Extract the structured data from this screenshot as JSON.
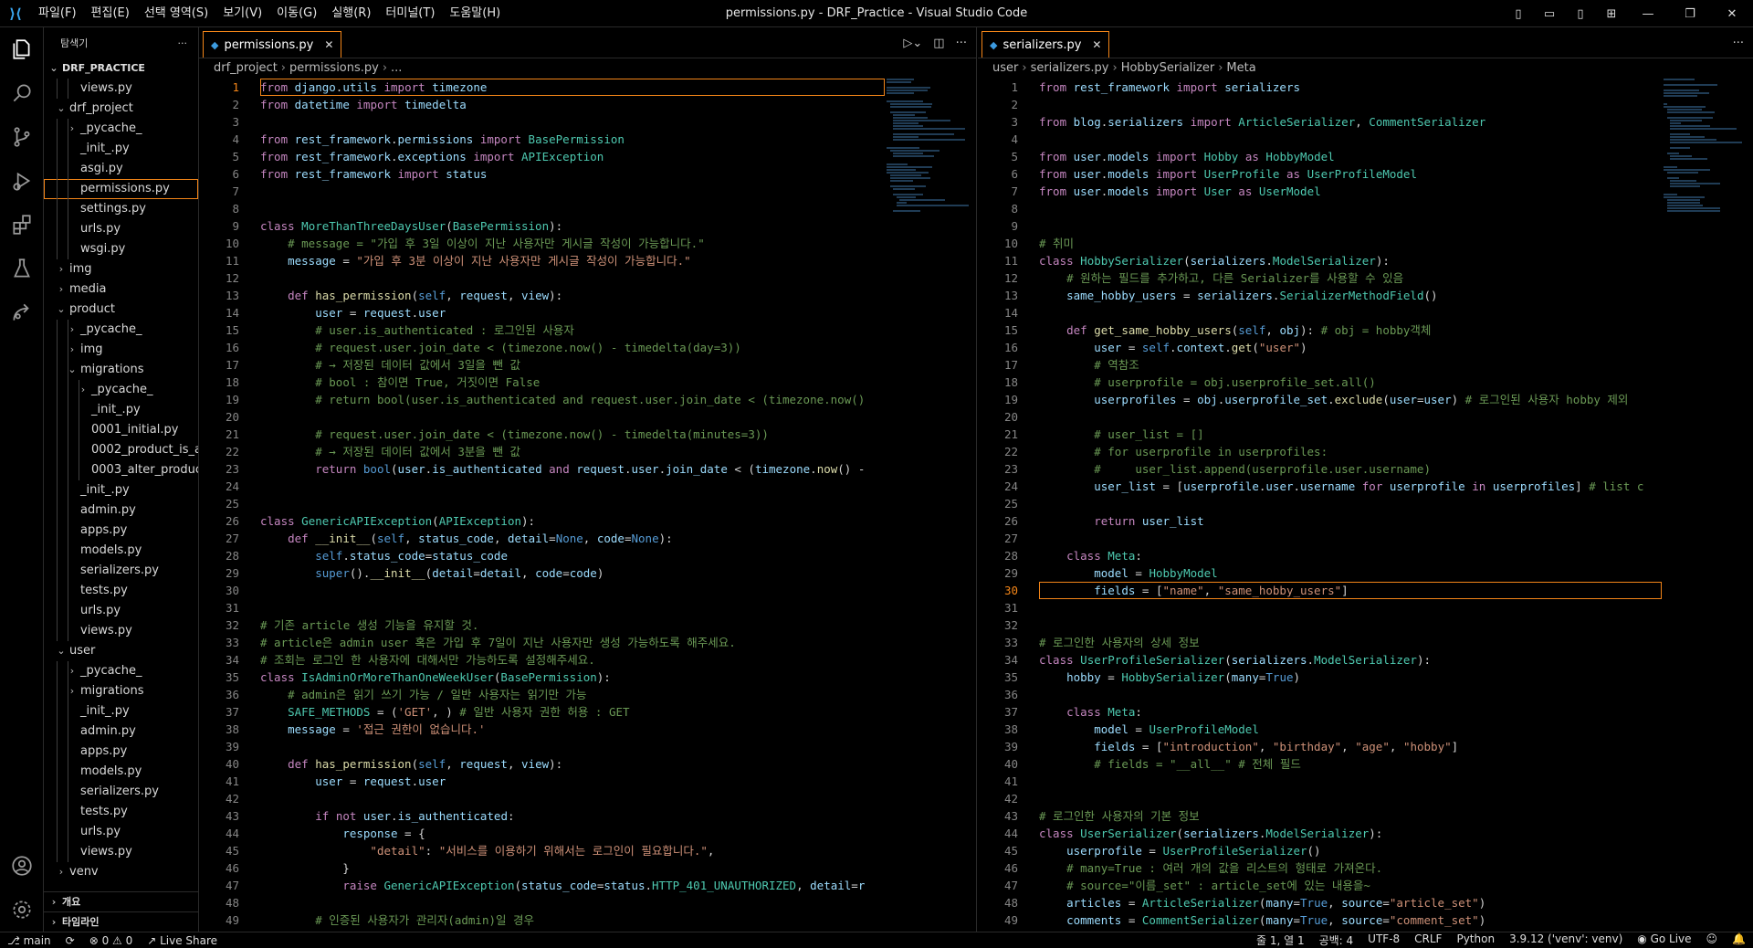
{
  "titlebar": {
    "menus": [
      "파일(F)",
      "편집(E)",
      "선택 영역(S)",
      "보기(V)",
      "이동(G)",
      "실행(R)",
      "터미널(T)",
      "도움말(H)"
    ],
    "title": "permissions.py - DRF_Practice - Visual Studio Code"
  },
  "sidebar": {
    "header": "탐색기",
    "more": "···",
    "root": "DRF_PRACTICE",
    "items": [
      {
        "label": "views.py",
        "depth": 1,
        "kind": "py"
      },
      {
        "label": "drf_project",
        "depth": 0,
        "kind": "open"
      },
      {
        "label": "_pycache_",
        "depth": 1,
        "kind": "closed"
      },
      {
        "label": "_init_.py",
        "depth": 1,
        "kind": "py"
      },
      {
        "label": "asgi.py",
        "depth": 1,
        "kind": "py"
      },
      {
        "label": "permissions.py",
        "depth": 1,
        "kind": "py",
        "selected": true
      },
      {
        "label": "settings.py",
        "depth": 1,
        "kind": "py"
      },
      {
        "label": "urls.py",
        "depth": 1,
        "kind": "py"
      },
      {
        "label": "wsgi.py",
        "depth": 1,
        "kind": "py"
      },
      {
        "label": "img",
        "depth": 0,
        "kind": "closed"
      },
      {
        "label": "media",
        "depth": 0,
        "kind": "closed"
      },
      {
        "label": "product",
        "depth": 0,
        "kind": "open"
      },
      {
        "label": "_pycache_",
        "depth": 1,
        "kind": "closed"
      },
      {
        "label": "img",
        "depth": 1,
        "kind": "closed"
      },
      {
        "label": "migrations",
        "depth": 1,
        "kind": "open"
      },
      {
        "label": "_pycache_",
        "depth": 2,
        "kind": "closed"
      },
      {
        "label": "_init_.py",
        "depth": 2,
        "kind": "py"
      },
      {
        "label": "0001_initial.py",
        "depth": 2,
        "kind": "py"
      },
      {
        "label": "0002_product_is_a...",
        "depth": 2,
        "kind": "py"
      },
      {
        "label": "0003_alter_produc...",
        "depth": 2,
        "kind": "py"
      },
      {
        "label": "_init_.py",
        "depth": 1,
        "kind": "py"
      },
      {
        "label": "admin.py",
        "depth": 1,
        "kind": "py"
      },
      {
        "label": "apps.py",
        "depth": 1,
        "kind": "py"
      },
      {
        "label": "models.py",
        "depth": 1,
        "kind": "py"
      },
      {
        "label": "serializers.py",
        "depth": 1,
        "kind": "py"
      },
      {
        "label": "tests.py",
        "depth": 1,
        "kind": "py"
      },
      {
        "label": "urls.py",
        "depth": 1,
        "kind": "py"
      },
      {
        "label": "views.py",
        "depth": 1,
        "kind": "py"
      },
      {
        "label": "user",
        "depth": 0,
        "kind": "open"
      },
      {
        "label": "_pycache_",
        "depth": 1,
        "kind": "closed"
      },
      {
        "label": "migrations",
        "depth": 1,
        "kind": "closed"
      },
      {
        "label": "_init_.py",
        "depth": 1,
        "kind": "py"
      },
      {
        "label": "admin.py",
        "depth": 1,
        "kind": "py"
      },
      {
        "label": "apps.py",
        "depth": 1,
        "kind": "py"
      },
      {
        "label": "models.py",
        "depth": 1,
        "kind": "py"
      },
      {
        "label": "serializers.py",
        "depth": 1,
        "kind": "py"
      },
      {
        "label": "tests.py",
        "depth": 1,
        "kind": "py"
      },
      {
        "label": "urls.py",
        "depth": 1,
        "kind": "py"
      },
      {
        "label": "views.py",
        "depth": 1,
        "kind": "py"
      },
      {
        "label": "venv",
        "depth": 0,
        "kind": "closed"
      }
    ],
    "outline": "개요",
    "timeline": "타임라인"
  },
  "editor1": {
    "tab": "permissions.py",
    "breadcrumb": [
      "drf_project",
      "permissions.py",
      "..."
    ],
    "current_line": 1,
    "lines": [
      "from django.utils import timezone",
      "from datetime import timedelta",
      "",
      "from rest_framework.permissions import BasePermission",
      "from rest_framework.exceptions import APIException",
      "from rest_framework import status",
      "",
      "",
      "class MoreThanThreeDaysUser(BasePermission):",
      "    # message = \"가입 후 3일 이상이 지난 사용자만 게시글 작성이 가능합니다.\"",
      "    message = \"가입 후 3분 이상이 지난 사용자만 게시글 작성이 가능합니다.\"",
      "",
      "    def has_permission(self, request, view):",
      "        user = request.user",
      "        # user.is_authenticated : 로그인된 사용자",
      "        # request.user.join_date < (timezone.now() - timedelta(day=3))",
      "        # → 저장된 데이터 값에서 3일을 뺀 값",
      "        # bool : 참이면 True, 거짓이면 False",
      "        # return bool(user.is_authenticated and request.user.join_date < (timezone.now()",
      "",
      "        # request.user.join_date < (timezone.now() - timedelta(minutes=3))",
      "        # → 저장된 데이터 값에서 3분을 뺀 값",
      "        return bool(user.is_authenticated and request.user.join_date < (timezone.now() -",
      "",
      "",
      "class GenericAPIException(APIException):",
      "    def __init__(self, status_code, detail=None, code=None):",
      "        self.status_code=status_code",
      "        super().__init__(detail=detail, code=code)",
      "",
      "",
      "# 기존 article 생성 기능을 유지할 것.",
      "# article은 admin user 혹은 가입 후 7일이 지난 사용자만 생성 가능하도록 해주세요.",
      "# 조회는 로그인 한 사용자에 대해서만 가능하도록 설정해주세요.",
      "class IsAdminOrMoreThanOneWeekUser(BasePermission):",
      "    # admin은 읽기 쓰기 가능 / 일반 사용자는 읽기만 가능",
      "    SAFE_METHODS = ('GET', ) # 일반 사용자 권한 허용 : GET",
      "    message = '접근 권한이 없습니다.'",
      "",
      "    def has_permission(self, request, view):",
      "        user = request.user",
      "",
      "        if not user.is_authenticated:",
      "            response = {",
      "                \"detail\": \"서비스를 이용하기 위해서는 로그인이 필요합니다.\",",
      "            }",
      "            raise GenericAPIException(status_code=status.HTTP_401_UNAUTHORIZED, detail=r",
      "",
      "        # 인증된 사용자가 관리자(admin)일 경우"
    ]
  },
  "editor2": {
    "tab": "serializers.py",
    "breadcrumb": [
      "user",
      "serializers.py",
      "HobbySerializer",
      "Meta"
    ],
    "current_line": 30,
    "lines": [
      "from rest_framework import serializers",
      "",
      "from blog.serializers import ArticleSerializer, CommentSerializer",
      "",
      "from user.models import Hobby as HobbyModel",
      "from user.models import UserProfile as UserProfileModel",
      "from user.models import User as UserModel",
      "",
      "",
      "# 취미",
      "class HobbySerializer(serializers.ModelSerializer):",
      "    # 원하는 필드를 추가하고, 다른 Serializer를 사용할 수 있음",
      "    same_hobby_users = serializers.SerializerMethodField()",
      "",
      "    def get_same_hobby_users(self, obj): # obj = hobby객체",
      "        user = self.context.get(\"user\")",
      "        # 역참조",
      "        # userprofile = obj.userprofile_set.all()",
      "        userprofiles = obj.userprofile_set.exclude(user=user) # 로그인된 사용자 hobby 제외",
      "",
      "        # user_list = []",
      "        # for userprofile in userprofiles:",
      "        #     user_list.append(userprofile.user.username)",
      "        user_list = [userprofile.user.username for userprofile in userprofiles] # list c",
      "",
      "        return user_list",
      "",
      "    class Meta:",
      "        model = HobbyModel",
      "        fields = [\"name\", \"same_hobby_users\"]",
      "",
      "",
      "# 로그인한 사용자의 상세 정보",
      "class UserProfileSerializer(serializers.ModelSerializer):",
      "    hobby = HobbySerializer(many=True)",
      "",
      "    class Meta:",
      "        model = UserProfileModel",
      "        fields = [\"introduction\", \"birthday\", \"age\", \"hobby\"]",
      "        # fields = \"__all__\" # 전체 필드",
      "",
      "",
      "# 로그인한 사용자의 기본 정보",
      "class UserSerializer(serializers.ModelSerializer):",
      "    userprofile = UserProfileSerializer()",
      "    # many=True : 여러 개의 값을 리스트의 형태로 가져온다.",
      "    # source=\"이름_set\" : article_set에 있는 내용을~",
      "    articles = ArticleSerializer(many=True, source=\"article_set\")",
      "    comments = CommentSerializer(many=True, source=\"comment_set\")"
    ]
  },
  "statusbar": {
    "branch": "main",
    "problems": "⊗ 0 ⚠ 0",
    "liveshare": "Live Share",
    "position": "줄 1, 열 1",
    "spaces": "공백: 4",
    "encoding": "UTF-8",
    "eol": "CRLF",
    "language": "Python",
    "interpreter": "3.9.12 ('venv': venv)",
    "golive": "Go Live"
  },
  "colors": {
    "accent": "#f38518",
    "background": "#000000",
    "python_icon": "#3c9be0"
  }
}
